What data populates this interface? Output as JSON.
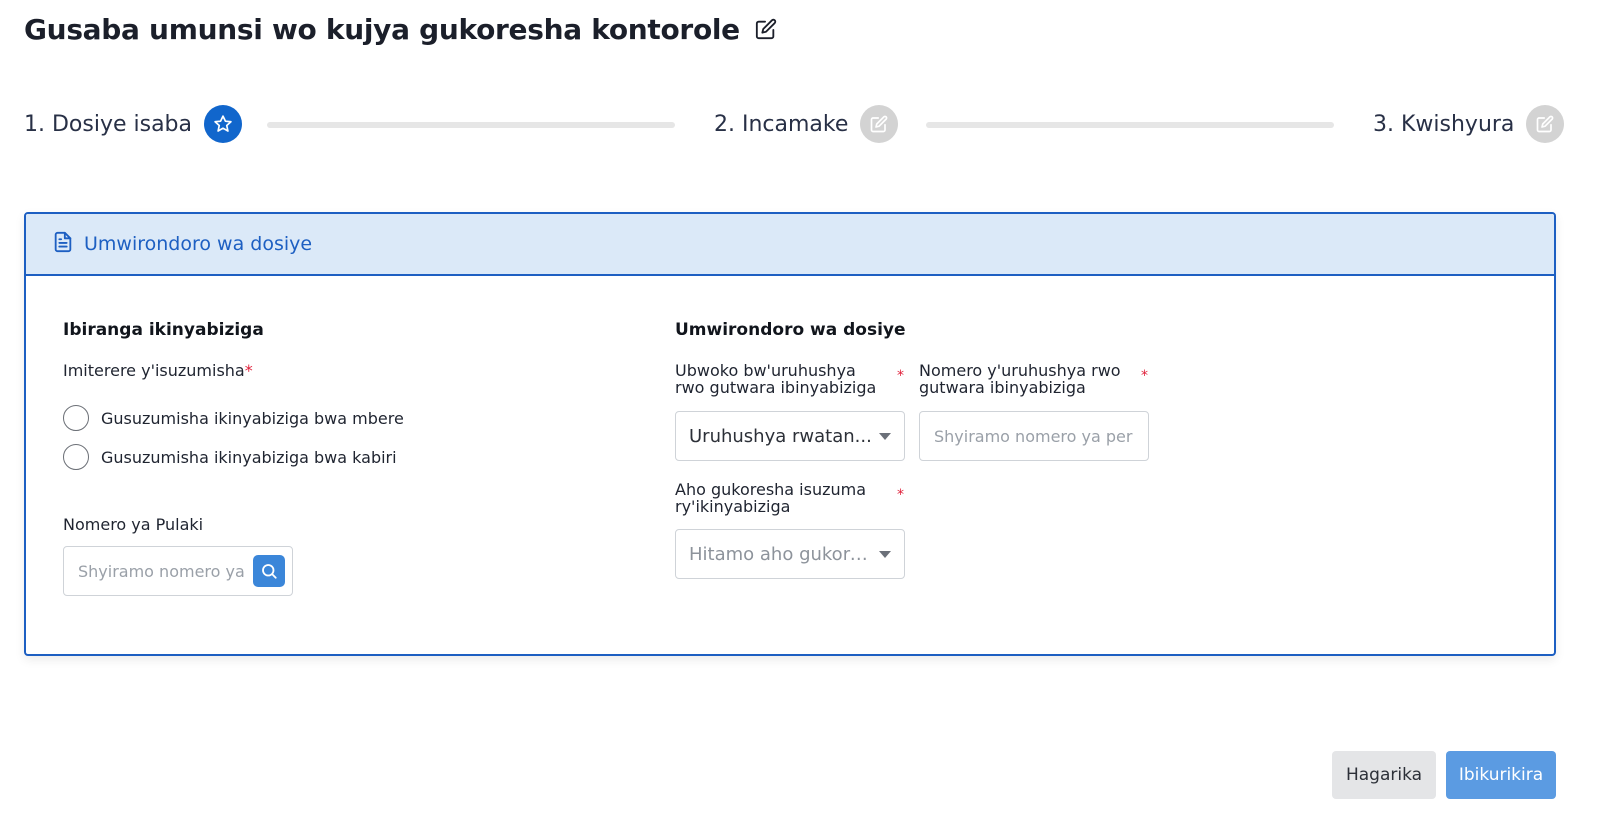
{
  "page": {
    "title": "Gusaba umunsi wo kujya gukoresha kontorole"
  },
  "stepper": {
    "steps": [
      {
        "label": "1. Dosiye isaba",
        "icon": "star-icon",
        "state": "active"
      },
      {
        "label": "2. Incamake",
        "icon": "edit-icon",
        "state": "inactive"
      },
      {
        "label": "3. Kwishyura",
        "icon": "edit-icon",
        "state": "inactive"
      }
    ]
  },
  "card": {
    "header_title": "Umwirondoro wa dosiye",
    "left": {
      "section_title": "Ibiranga ikinyabiziga",
      "inspection_type_label": "Imiterere y'isuzumisha",
      "required_marker": "*",
      "radio_options": [
        "Gusuzumisha ikinyabiziga bwa mbere",
        "Gusuzumisha ikinyabiziga bwa kabiri"
      ],
      "plate_label": "Nomero ya Pulaki",
      "plate_placeholder": "Shyiramo nomero ya pulaki"
    },
    "right": {
      "section_title": "Umwirondoro wa dosiye",
      "license_type_label": "Ubwoko bw'uruhushya rwo gutwara ibinyabiziga",
      "license_type_value": "Uruhushya rwatan...",
      "license_number_label": "Nomero y'uruhushya rwo gutwara ibinyabiziga",
      "license_number_placeholder": "Shyiramo nomero ya perimi",
      "location_label": "Aho gukoresha isuzuma ry'ikinyabiziga",
      "location_placeholder": "Hitamo aho gukorera",
      "required_marker": "*"
    }
  },
  "actions": {
    "cancel_label": "Hagarika",
    "next_label": "Ibikurikira"
  },
  "colors": {
    "primary": "#1d5fc2",
    "active_step": "#1166cc",
    "header_bg": "#dbe9f8",
    "next_button": "#5b9be2",
    "required": "#e0203a"
  }
}
